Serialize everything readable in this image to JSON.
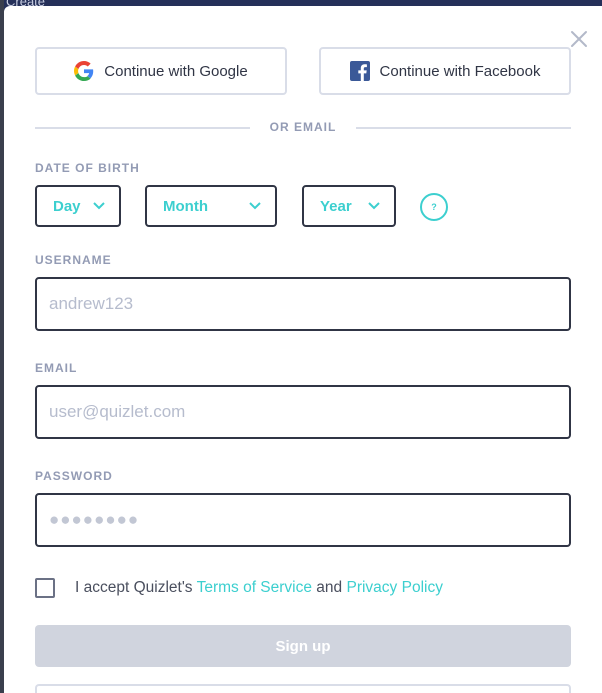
{
  "backdrop": {
    "label": "Create"
  },
  "social": {
    "google_label": "Continue with Google",
    "facebook_label": "Continue with Facebook"
  },
  "divider": {
    "text": "OR EMAIL"
  },
  "dob": {
    "label": "DATE OF BIRTH",
    "day": "Day",
    "month": "Month",
    "year": "Year",
    "help": "?"
  },
  "username": {
    "label": "USERNAME",
    "placeholder": "andrew123"
  },
  "email": {
    "label": "EMAIL",
    "placeholder": "user@quizlet.com"
  },
  "password": {
    "label": "PASSWORD",
    "placeholder": "●●●●●●●●"
  },
  "terms": {
    "prefix": "I accept Quizlet's ",
    "tos": "Terms of Service",
    "and": " and ",
    "privacy": "Privacy Policy"
  },
  "signup": {
    "label": "Sign up"
  },
  "colors": {
    "accent": "#3ccfcf",
    "border": "#303545",
    "label": "#939bb4",
    "disabled_button": "#d0d4de"
  },
  "icons": {
    "close": "close-icon",
    "google": "google-icon",
    "facebook": "facebook-icon",
    "chevron": "chevron-down-icon"
  }
}
